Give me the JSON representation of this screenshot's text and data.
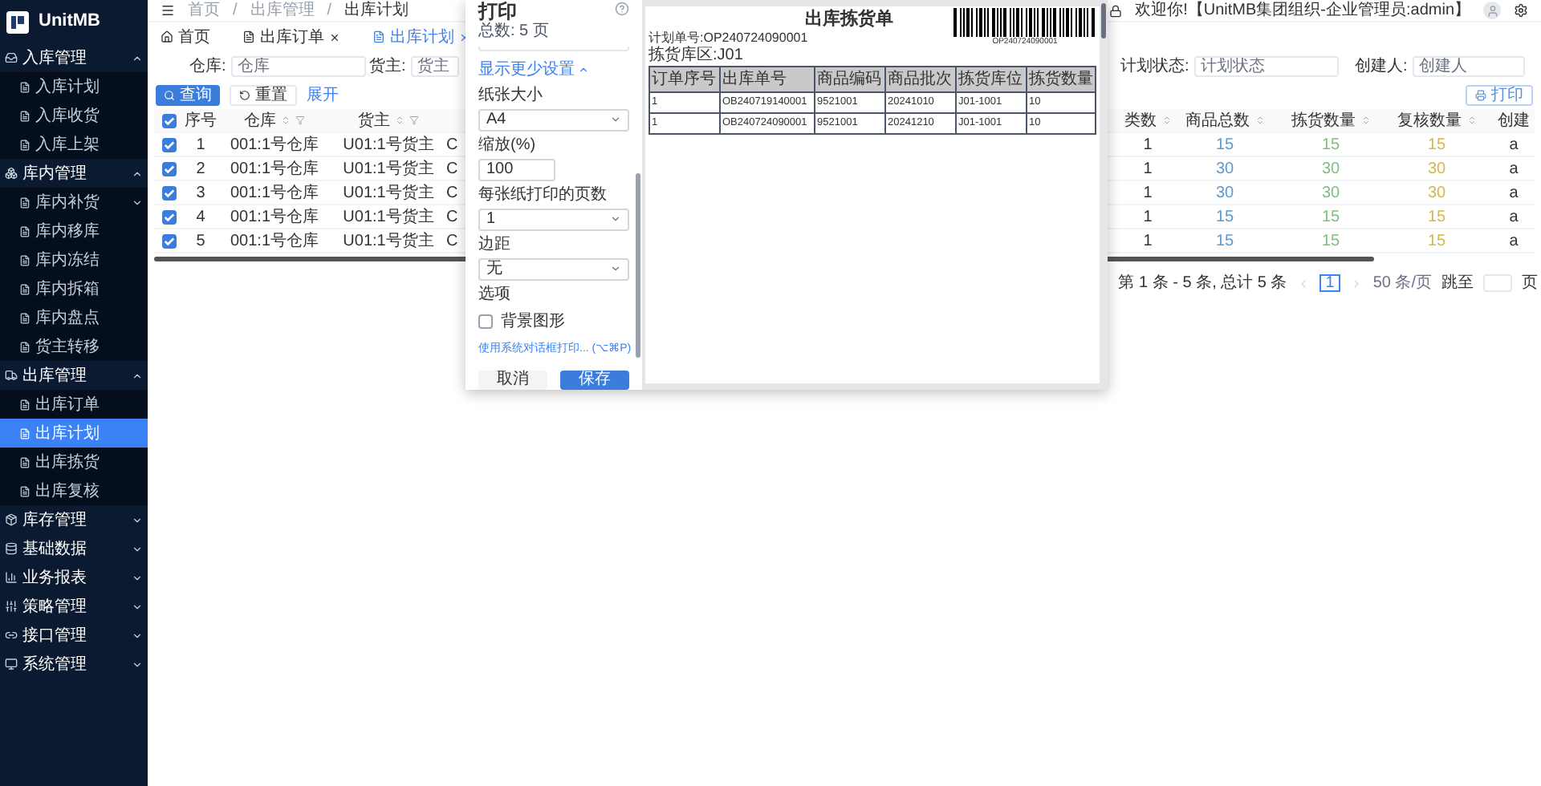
{
  "app": {
    "name": "UnitMB"
  },
  "sidebar": {
    "groups": [
      {
        "label": "入库管理",
        "expanded": true,
        "children": [
          {
            "label": "入库计划",
            "selected": false
          },
          {
            "label": "入库收货",
            "selected": false
          },
          {
            "label": "入库上架",
            "selected": false
          }
        ]
      },
      {
        "label": "库内管理",
        "expanded": true,
        "children": [
          {
            "label": "库内补货",
            "selected": false,
            "expandable": true
          },
          {
            "label": "库内移库",
            "selected": false
          },
          {
            "label": "库内冻结",
            "selected": false
          },
          {
            "label": "库内拆箱",
            "selected": false
          },
          {
            "label": "库内盘点",
            "selected": false
          },
          {
            "label": "货主转移",
            "selected": false
          }
        ]
      },
      {
        "label": "出库管理",
        "expanded": true,
        "children": [
          {
            "label": "出库订单",
            "selected": false
          },
          {
            "label": "出库计划",
            "selected": true
          },
          {
            "label": "出库拣货",
            "selected": false
          },
          {
            "label": "出库复核",
            "selected": false
          }
        ]
      },
      {
        "label": "库存管理",
        "expanded": false
      },
      {
        "label": "基础数据",
        "expanded": false
      },
      {
        "label": "业务报表",
        "expanded": false
      },
      {
        "label": "策略管理",
        "expanded": false
      },
      {
        "label": "接口管理",
        "expanded": false
      },
      {
        "label": "系统管理",
        "expanded": false
      }
    ]
  },
  "header": {
    "breadcrumb": [
      "首页",
      "出库管理",
      "出库计划"
    ],
    "separator": "/",
    "welcome": "欢迎你!【UnitMB集团组织-企业管理员:admin】"
  },
  "tabs": [
    {
      "label": "首页",
      "selected": false,
      "closable": false
    },
    {
      "label": "出库订单",
      "selected": false,
      "closable": true
    },
    {
      "label": "出库计划",
      "selected": true,
      "closable": true
    }
  ],
  "filters": [
    {
      "label": "仓库:",
      "placeholder": "仓库"
    },
    {
      "label": "货主:",
      "placeholder": "货主"
    },
    {
      "label": "计划状态:",
      "placeholder": "计划状态"
    },
    {
      "label": "创建人:",
      "placeholder": "创建人"
    }
  ],
  "actions": {
    "query": "查询",
    "reset": "重置",
    "expand": "展开",
    "print": "打印"
  },
  "table": {
    "all_checked": true,
    "columns": [
      {
        "label": "序号"
      },
      {
        "label": "仓库",
        "sortable": true,
        "filter": true
      },
      {
        "label": "货主",
        "sortable": true,
        "filter": true
      },
      {},
      {
        "label": "类数",
        "sortable": true
      },
      {
        "label": "商品总数",
        "sortable": true,
        "color": "#5b9bd5"
      },
      {
        "label": "拣货数量",
        "sortable": true,
        "color": "#7fbf7f"
      },
      {
        "label": "复核数量",
        "sortable": true,
        "color": "#d4b84a"
      },
      {
        "label": "创建"
      }
    ],
    "rows": [
      {
        "checked": true,
        "cells": [
          "1",
          "001:1号仓库",
          "U01:1号货主",
          "C",
          "1",
          "15",
          "15",
          "15",
          "a"
        ]
      },
      {
        "checked": true,
        "cells": [
          "2",
          "001:1号仓库",
          "U01:1号货主",
          "C",
          "1",
          "30",
          "30",
          "30",
          "a"
        ]
      },
      {
        "checked": true,
        "cells": [
          "3",
          "001:1号仓库",
          "U01:1号货主",
          "C",
          "1",
          "30",
          "30",
          "30",
          "a"
        ]
      },
      {
        "checked": true,
        "cells": [
          "4",
          "001:1号仓库",
          "U01:1号货主",
          "C",
          "1",
          "15",
          "15",
          "15",
          "a"
        ]
      },
      {
        "checked": true,
        "cells": [
          "5",
          "001:1号仓库",
          "U01:1号货主",
          "C",
          "1",
          "15",
          "15",
          "15",
          "a"
        ]
      }
    ]
  },
  "pagination": {
    "summary": "第 1 条 - 5 条, 总计 5 条",
    "page": "1",
    "page_size": "50 条/页",
    "jump": "跳至",
    "unit": "页"
  },
  "print_dialog": {
    "title": "打印",
    "total": "总数: 5 页",
    "less_settings": "显示更少设置",
    "settings": [
      {
        "kind": "select",
        "label": "纸张大小",
        "value": "A4"
      },
      {
        "kind": "input",
        "label": "缩放(%)",
        "value": "100"
      },
      {
        "kind": "select",
        "label": "每张纸打印的页数",
        "value": "1"
      },
      {
        "kind": "select",
        "label": "边距",
        "value": "无"
      },
      {
        "kind": "checkbox",
        "label": "选项",
        "option": "背景图形",
        "checked": false
      }
    ],
    "system_link": "使用系统对话框打印... (⌥⌘P)",
    "cancel": "取消",
    "save": "保存",
    "preview": {
      "title": "出库拣货单",
      "barcode_text": "OP240724090001",
      "plan_no": "计划单号:OP240724090001",
      "zone": "拣货库区:J01",
      "columns": [
        "订单序号",
        "出库单号",
        "商品编码",
        "商品批次",
        "拣货库位",
        "拣货数量"
      ],
      "rows": [
        [
          "1",
          "OB240719140001",
          "9521001",
          "20241010",
          "J01-1001",
          "10"
        ],
        [
          "1",
          "OB240724090001",
          "9521001",
          "20241210",
          "J01-1001",
          "10"
        ]
      ]
    }
  }
}
